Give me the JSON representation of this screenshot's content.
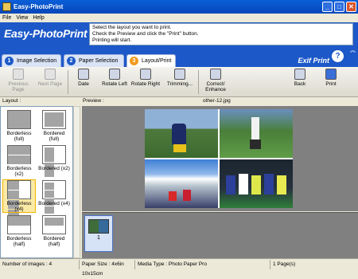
{
  "window": {
    "title": "Easy-PhotoPrint"
  },
  "menu": [
    "File",
    "View",
    "Help"
  ],
  "banner": {
    "logo": "Easy-PhotoPrint",
    "instructions": [
      "Select the layout you want to print.",
      "Check the Preview and click the \"Print\" button.",
      "Printing will start."
    ]
  },
  "tabs": [
    {
      "num": "1",
      "label": "Image Selection"
    },
    {
      "num": "2",
      "label": "Paper Selection"
    },
    {
      "num": "3",
      "label": "Layout/Print"
    }
  ],
  "exif_label": "Exif Print",
  "toolbar": {
    "prev": "Previous Page",
    "next": "Next Page",
    "date": "Date",
    "rotate_left": "Rotate Left",
    "rotate_right": "Rotate Right",
    "trimming": "Trimming...",
    "correct": "Correct/ Enhance",
    "back": "Back",
    "print": "Print"
  },
  "layout_panel": {
    "header": "Layout :",
    "items": [
      "Borderless (full)",
      "Bordered (full)",
      "Borderless (x2)",
      "Bordered (x2)",
      "Borderless (x4)",
      "Bordered (x4)",
      "Borderless (half)",
      "Bordered (half)"
    ],
    "selected": "Borderless (x4)"
  },
  "preview": {
    "header": "Preview :",
    "filename": "other-12.jpg"
  },
  "thumbnails": [
    {
      "page": "1"
    }
  ],
  "status": {
    "count": "Number of images : 4",
    "paper": "Paper Size : 4x6in 10x15cm",
    "media": "Media Type : Photo Paper Pro",
    "pages": "1 Page(s)"
  }
}
